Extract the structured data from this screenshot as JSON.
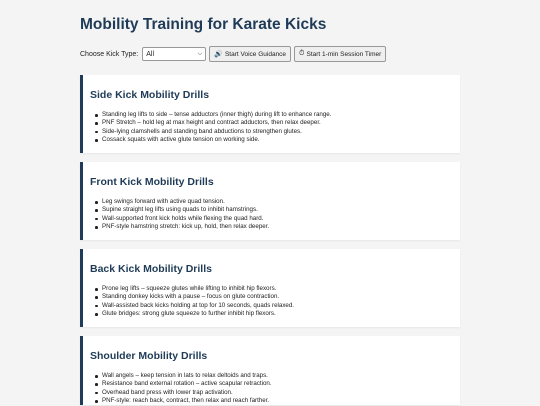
{
  "page": {
    "title": "Mobility Training for Karate Kicks"
  },
  "controls": {
    "kick_type_label": "Choose Kick Type:",
    "kick_type_selected": "All",
    "voice_button": {
      "icon": "speaker-icon",
      "label": "Start Voice Guidance"
    },
    "timer_button": {
      "icon": "stopwatch-icon",
      "label": "Start 1-min Session Timer"
    }
  },
  "sections": [
    {
      "title": "Side Kick Mobility Drills",
      "items": [
        "Standing leg lifts to side – tense adductors (inner thigh) during lift to enhance range.",
        "PNF Stretch – hold leg at max height and contract adductors, then relax deeper.",
        "Side-lying clamshells and standing band abductions to strengthen glutes.",
        "Cossack squats with active glute tension on working side."
      ]
    },
    {
      "title": "Front Kick Mobility Drills",
      "items": [
        "Leg swings forward with active quad tension.",
        "Supine straight leg lifts using quads to inhibit hamstrings.",
        "Wall-supported front kick holds while flexing the quad hard.",
        "PNF-style hamstring stretch: kick up, hold, then relax deeper."
      ]
    },
    {
      "title": "Back Kick Mobility Drills",
      "items": [
        "Prone leg lifts – squeeze glutes while lifting to inhibit hip flexors.",
        "Standing donkey kicks with a pause – focus on glute contraction.",
        "Wall-assisted back kicks holding at top for 10 seconds, quads relaxed.",
        "Glute bridges: strong glute squeeze to further inhibit hip flexors."
      ]
    },
    {
      "title": "Shoulder Mobility Drills",
      "items": [
        "Wall angels – keep tension in lats to relax deltoids and traps.",
        "Resistance band external rotation – active scapular retraction.",
        "Overhead band press with lower trap activation.",
        "PNF-style: reach back, contract, then relax and reach farther."
      ]
    }
  ]
}
